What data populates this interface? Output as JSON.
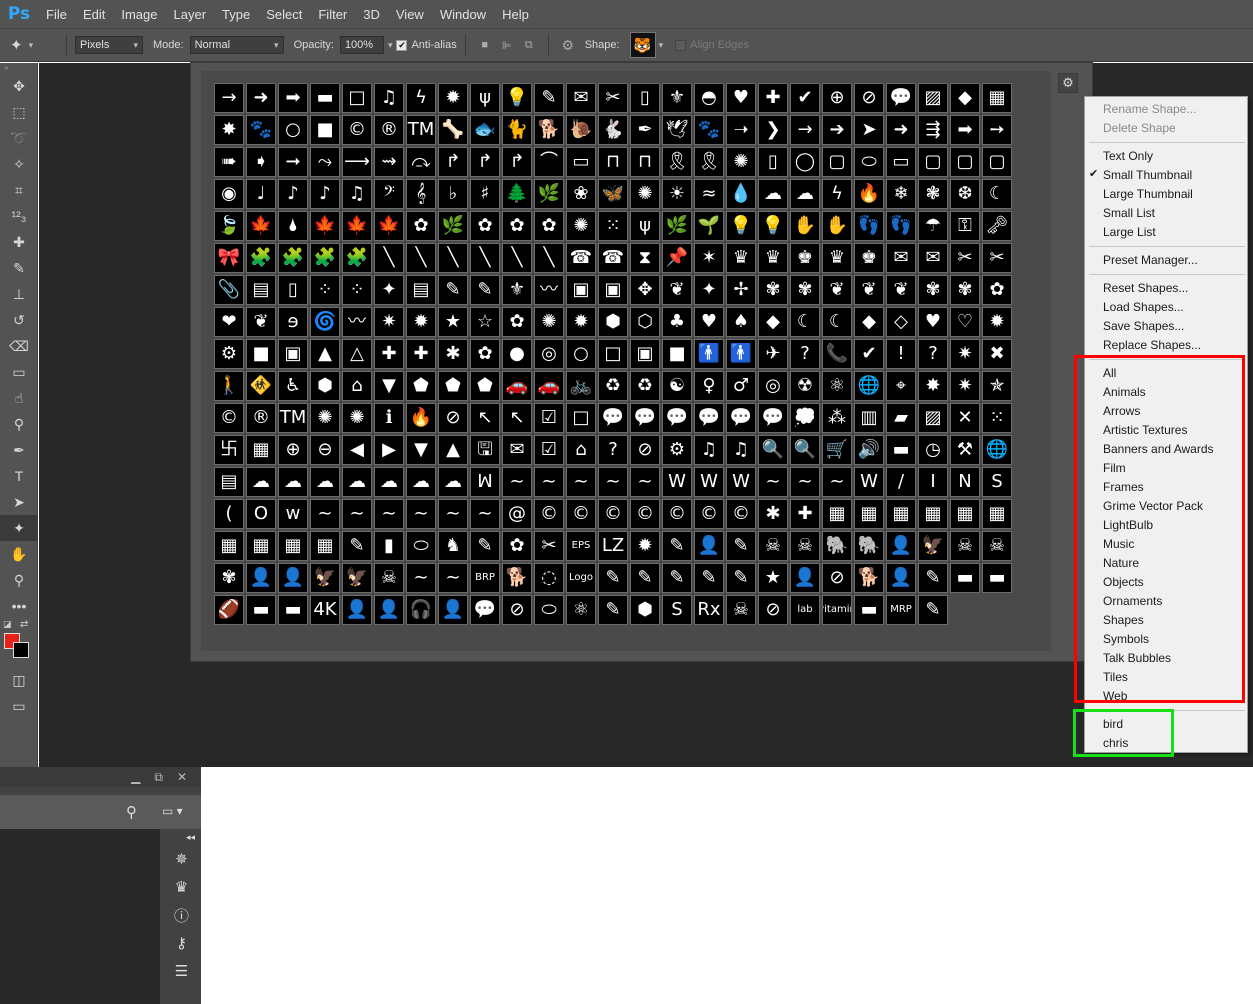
{
  "menubar": {
    "logo": "Ps",
    "items": [
      "File",
      "Edit",
      "Image",
      "Layer",
      "Type",
      "Select",
      "Filter",
      "3D",
      "View",
      "Window",
      "Help"
    ]
  },
  "options": {
    "mode_select": "Pixels",
    "mode_label": "Mode:",
    "mode_value": "Normal",
    "opacity_label": "Opacity:",
    "opacity_value": "100%",
    "antialias_label": "Anti-alias",
    "shape_label": "Shape:",
    "align_edges_label": "Align Edges"
  },
  "left_tools": [
    "move-tool-icon",
    "marquee-tool-icon",
    "lasso-tool-icon",
    "magic-wand-icon",
    "crop-tool-icon",
    "count-tool-icon",
    "healing-brush-icon",
    "brush-tool-icon",
    "clone-stamp-icon",
    "history-brush-icon",
    "eraser-icon",
    "gradient-icon",
    "smudge-icon",
    "dodge-icon",
    "pen-tool-icon",
    "type-tool-icon",
    "path-selection-icon",
    "custom-shape-icon",
    "hand-tool-icon",
    "zoom-tool-icon",
    "more-tools-icon"
  ],
  "colors": {
    "foreground": "#e8221b",
    "background": "#000000"
  },
  "picker": {
    "glyphs": [
      "→",
      "➜",
      "➡",
      "▬",
      "□",
      "♫",
      "ϟ",
      "✹",
      "ψ",
      "💡",
      "✎",
      "✉",
      "✂",
      "▯",
      "⚜",
      "◓",
      "♥",
      "✚",
      "✔",
      "⊕",
      "⊘",
      "💬",
      "▨",
      "◆",
      "▦",
      "✸",
      "🐾",
      "○",
      "■",
      "©",
      "®",
      "TM",
      "🦴",
      "🐟",
      "🐈",
      "🐕",
      "🐌",
      "🐇",
      "✒",
      "🕊",
      "🐾",
      "➝",
      "❯",
      "→",
      "➔",
      "➤",
      "➜",
      "⇶",
      "➡",
      "➙",
      "➠",
      "➧",
      "➞",
      "⤳",
      "⟶",
      "⇝",
      "⤼",
      "↱",
      "↱",
      "↱",
      "⌒",
      "▭",
      "⊓",
      "⊓",
      "🎗",
      "🎗",
      "✺",
      "▯",
      "◯",
      "▢",
      "⬭",
      "▭",
      "▢",
      "▢",
      "▢",
      "◉",
      "♩",
      "♪",
      "♪",
      "♫",
      "𝄢",
      "𝄞",
      "♭",
      "♯",
      "🌲",
      "🌿",
      "❀",
      "🦋",
      "✺",
      "☀",
      "≈",
      "💧",
      "☁",
      "☁",
      "ϟ",
      "🔥",
      "❄",
      "❃",
      "❆",
      "☾",
      "🍃",
      "🍁",
      "🌢",
      "🍁",
      "🍁",
      "🍁",
      "✿",
      "🌿",
      "✿",
      "✿",
      "✿",
      "✺",
      "⁙",
      "ψ",
      "🌿",
      "🌱",
      "💡",
      "💡",
      "✋",
      "✋",
      "👣",
      "👣",
      "☂",
      "⚿",
      "🗝",
      "🎀",
      "🧩",
      "🧩",
      "🧩",
      "🧩",
      "╲",
      "╲",
      "╲",
      "╲",
      "╲",
      "╲",
      "☎",
      "☎",
      "⧗",
      "📌",
      "✶",
      "♛",
      "♛",
      "♚",
      "♛",
      "♚",
      "✉",
      "✉",
      "✂",
      "✂",
      "📎",
      "▤",
      "▯",
      "⁘",
      "⁘",
      "✦",
      "▤",
      "✎",
      "✎",
      "⚜",
      "〰",
      "▣",
      "▣",
      "✥",
      "❦",
      "✦",
      "✢",
      "✾",
      "✾",
      "❦",
      "❦",
      "❦",
      "✾",
      "✾",
      "✿",
      "❤",
      "❦",
      "ɘ",
      "🌀",
      "〰",
      "✷",
      "✹",
      "★",
      "☆",
      "✿",
      "✺",
      "✹",
      "⬢",
      "⬡",
      "♣",
      "♥",
      "♠",
      "◆",
      "☾",
      "☾",
      "◆",
      "◇",
      "♥",
      "♡",
      "✹",
      "⚙",
      "■",
      "▣",
      "▲",
      "△",
      "✚",
      "✚",
      "✱",
      "✿",
      "●",
      "◎",
      "○",
      "□",
      "▣",
      "■",
      "🚹",
      "🚹",
      "✈",
      "?",
      "📞",
      "✔",
      "!",
      "?",
      "✷",
      "✖",
      "🚶",
      "🚸",
      "♿",
      "⬢",
      "⌂",
      "▼",
      "⬟",
      "⬟",
      "⬟",
      "🚗",
      "🚗",
      "🚲",
      "♻",
      "♻",
      "☯",
      "♀",
      "♂",
      "◎",
      "☢",
      "⚛",
      "🌐",
      "⌖",
      "✸",
      "✷",
      "✯",
      "©",
      "®",
      "TM",
      "✺",
      "✺",
      "ℹ",
      "🔥",
      "⊘",
      "↖",
      "↖",
      "☑",
      "□",
      "💬",
      "💬",
      "💬",
      "💬",
      "💬",
      "💬",
      "💭",
      "⁂",
      "▥",
      "▰",
      "▨",
      "✕",
      "⁙",
      "卐",
      "▦",
      "⊕",
      "⊖",
      "◀",
      "▶",
      "▼",
      "▲",
      "🖫",
      "✉",
      "☑",
      "⌂",
      "?",
      "⊘",
      "⚙",
      "♫",
      "♫",
      "🔍",
      "🔍",
      "🛒",
      "🔊",
      "▬",
      "◷",
      "⚒",
      "🌐",
      "▤",
      "☁",
      "☁",
      "☁",
      "☁",
      "☁",
      "☁",
      "☁",
      "ꟽ",
      "~",
      "~",
      "~",
      "~",
      "~",
      "W",
      "W",
      "W",
      "~",
      "~",
      "~",
      "W",
      "/",
      "I",
      "N",
      "S",
      "(",
      "O",
      "w",
      "~",
      "~",
      "~",
      "~",
      "~",
      "~",
      "@",
      "©",
      "©",
      "©",
      "©",
      "©",
      "©",
      "©",
      "✱",
      "✚",
      "▦",
      "▦",
      "▦",
      "▦",
      "▦",
      "▦",
      "▦",
      "▦",
      "▦",
      "▦",
      "✎",
      "▮",
      "⬭",
      "♞",
      "✎",
      "✿",
      "✂",
      "EPS",
      "LZ",
      "✹",
      "✎",
      "👤",
      "✎",
      "☠",
      "☠",
      "🐘",
      "🐘",
      "👤",
      "🦅",
      "☠",
      "☠",
      "✾",
      "👤",
      "👤",
      "🦅",
      "🦅",
      "☠",
      "~",
      "~",
      "BRP",
      "🐕",
      "◌",
      "Logo",
      "✎",
      "✎",
      "✎",
      "✎",
      "✎",
      "★",
      "👤",
      "⊘",
      "🐕",
      "👤",
      "✎",
      "▬",
      "▬",
      "🏈",
      "▬",
      "▬",
      "4K",
      "👤",
      "👤",
      "🎧",
      "👤",
      "💬",
      "⊘",
      "⬭",
      "⚛",
      "✎",
      "⬢",
      "S",
      "Rx",
      "☠",
      "⊘",
      "lab",
      "vitamin",
      "▬",
      "MRP",
      "✎"
    ]
  },
  "flyout": {
    "top_items": [
      "Rename Shape...",
      "Delete Shape"
    ],
    "view_items": [
      "Text Only",
      "Small Thumbnail",
      "Large Thumbnail",
      "Small List",
      "Large List"
    ],
    "checked_item": "Small Thumbnail",
    "manager_items": [
      "Preset Manager..."
    ],
    "shape_ops": [
      "Reset Shapes...",
      "Load Shapes...",
      "Save Shapes...",
      "Replace Shapes..."
    ],
    "library_items": [
      "All",
      "Animals",
      "Arrows",
      "Artistic Textures",
      "Banners and Awards",
      "Film",
      "Frames",
      "Grime Vector Pack",
      "LightBulb",
      "Music",
      "Nature",
      "Objects",
      "Ornaments",
      "Shapes",
      "Symbols",
      "Talk Bubbles",
      "Tiles",
      "Web"
    ],
    "custom_items": [
      "bird",
      "chris"
    ]
  },
  "highlights": {
    "red": "#ff0000",
    "green": "#16e016",
    "blue": "#0000ff"
  }
}
